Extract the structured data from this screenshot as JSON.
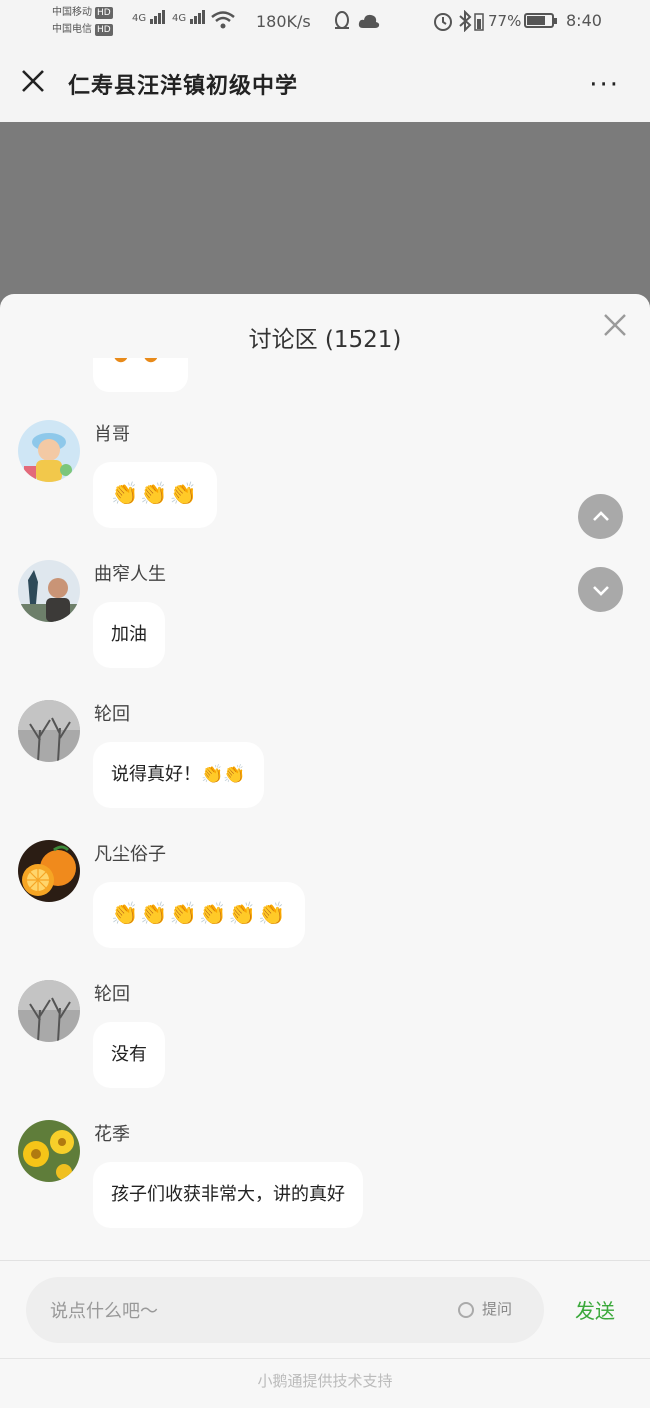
{
  "status_bar": {
    "carrier1": "中国移动",
    "carrier2": "中国电信",
    "hd": "HD",
    "net1": "4G",
    "net2": "4G",
    "speed": "180K/s",
    "battery": "77%",
    "battery_level": 0.77,
    "time": "8:40"
  },
  "header": {
    "title": "仁寿县汪洋镇初级中学",
    "more": "···"
  },
  "panel": {
    "title": "讨论区 (1521)"
  },
  "messages": [
    {
      "name": "肖哥",
      "text": "👏👏👏"
    },
    {
      "name": "曲窄人生",
      "text": "加油"
    },
    {
      "name": "轮回",
      "text": "说得真好！👏👏"
    },
    {
      "name": "凡尘俗子",
      "text": "👏👏👏👏👏👏"
    },
    {
      "name": "轮回",
      "text": "没有"
    },
    {
      "name": "花季",
      "text": "孩子们收获非常大，讲的真好"
    }
  ],
  "input": {
    "placeholder": "说点什么吧～",
    "ask_label": "提问",
    "send_label": "发送"
  },
  "footer": {
    "text": "小鹅通提供技术支持"
  }
}
